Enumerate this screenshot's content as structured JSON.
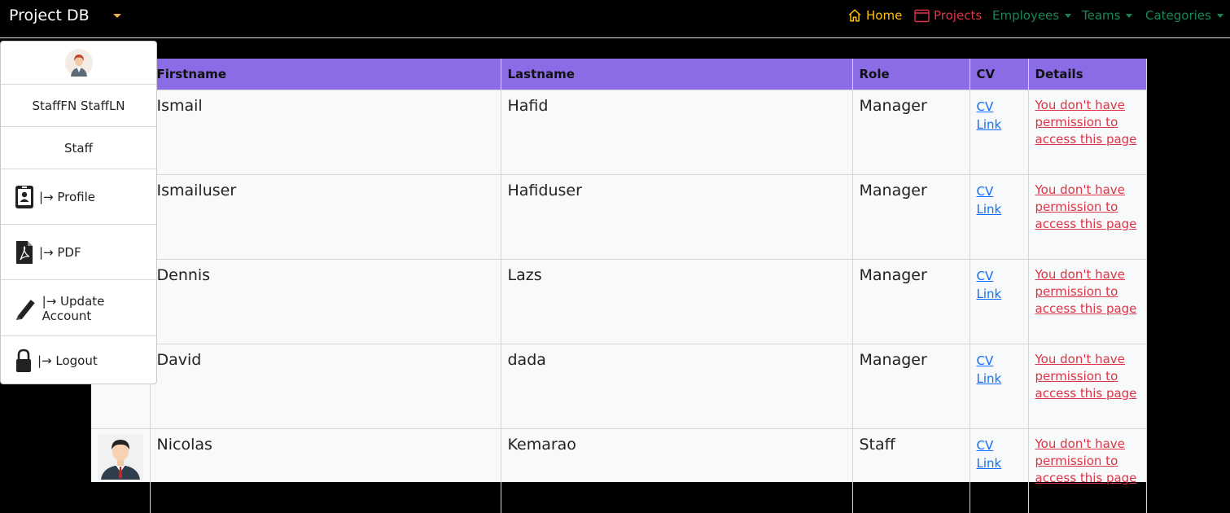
{
  "navbar": {
    "brand": "Project DB",
    "links": [
      {
        "label": "Home",
        "color": "#ffc107"
      },
      {
        "label": "Projects",
        "color": "#dc3545"
      },
      {
        "label": "Employees",
        "color": "#198754"
      },
      {
        "label": "Teams",
        "color": "#198754"
      },
      {
        "label": "Categories",
        "color": "#198754"
      }
    ]
  },
  "table": {
    "headers": [
      "",
      "Firstname",
      "Lastname",
      "Role",
      "CV",
      "Details"
    ],
    "rows": [
      {
        "firstname": "Ismail",
        "lastname": "Hafid",
        "role": "Manager",
        "cv": "CV Link",
        "details": "You don't have permission to access this page"
      },
      {
        "firstname": "Ismailuser",
        "lastname": "Hafiduser",
        "role": "Manager",
        "cv": "CV Link",
        "details": "You don't have permission to access this page"
      },
      {
        "firstname": "Dennis",
        "lastname": "Lazs",
        "role": "Manager",
        "cv": "CV Link",
        "details": "You don't have permission to access this page"
      },
      {
        "firstname": "David",
        "lastname": "dada",
        "role": "Manager",
        "cv": "CV Link",
        "details": "You don't have permission to access this page"
      },
      {
        "firstname": "Nicolas",
        "lastname": "Kemarao",
        "role": "Staff",
        "cv": "CV Link",
        "details": "You don't have permission to access this page"
      }
    ]
  },
  "user_menu": {
    "name": "StaffFN StaffLN",
    "role": "Staff",
    "items": [
      {
        "label": "|→ Profile",
        "icon": "id-badge-icon"
      },
      {
        "label": "|→ PDF",
        "icon": "pdf-file-icon"
      },
      {
        "label": "|→ Update Account",
        "icon": "pen-icon"
      },
      {
        "label": "|→ Logout",
        "icon": "lock-icon"
      }
    ]
  },
  "colors": {
    "header_bg": "#8c6be6",
    "home": "#ffc107",
    "projects": "#dc3545",
    "nav_green": "#198754",
    "link_blue": "#0d6efd",
    "denied_red": "#dc3545"
  }
}
